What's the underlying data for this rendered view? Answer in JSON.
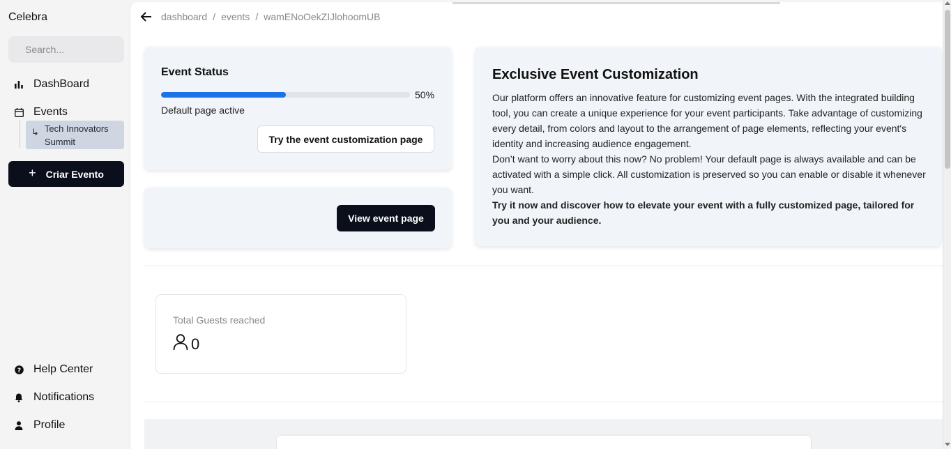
{
  "sidebar": {
    "brand": "Celebra",
    "search_placeholder": "Search...",
    "nav": {
      "dashboard": "DashBoard",
      "events": "Events",
      "event_child": "Tech Innovators Summit",
      "create_button": "Criar Evento",
      "help": "Help Center",
      "notifications": "Notifications",
      "profile": "Profile"
    }
  },
  "breadcrumb": {
    "items": [
      "dashboard",
      "events",
      "wamENoOekZIJlohoomUB"
    ],
    "separator": "/"
  },
  "status_card": {
    "title": "Event Status",
    "progress_percent": 50,
    "progress_label": "50%",
    "status_text": "Default page active",
    "try_button": "Try the event customization page"
  },
  "view_card": {
    "view_button": "View event page"
  },
  "customization_card": {
    "title": "Exclusive Event Customization",
    "paragraph1": "Our platform offers an innovative feature for customizing event pages. With the integrated building tool, you can create a unique experience for your event participants. Take advantage of customizing every detail, from colors and layout to the arrangement of page elements, reflecting your event's identity and increasing audience engagement.",
    "paragraph2": "Don’t want to worry about this now? No problem! Your default page is always available and can be activated with a simple click. All customization is preserved so you can enable or disable it whenever you want.",
    "paragraph3": "Try it now and discover how to elevate your event with a fully customized page, tailored for you and your audience."
  },
  "guests_card": {
    "label": "Total Guests reached",
    "value": "0"
  },
  "colors": {
    "accent": "#1d72e8",
    "primary_dark": "#0b0f1c",
    "card_bg": "#f1f4f9",
    "sidebar_selected": "#cfd6e1"
  }
}
